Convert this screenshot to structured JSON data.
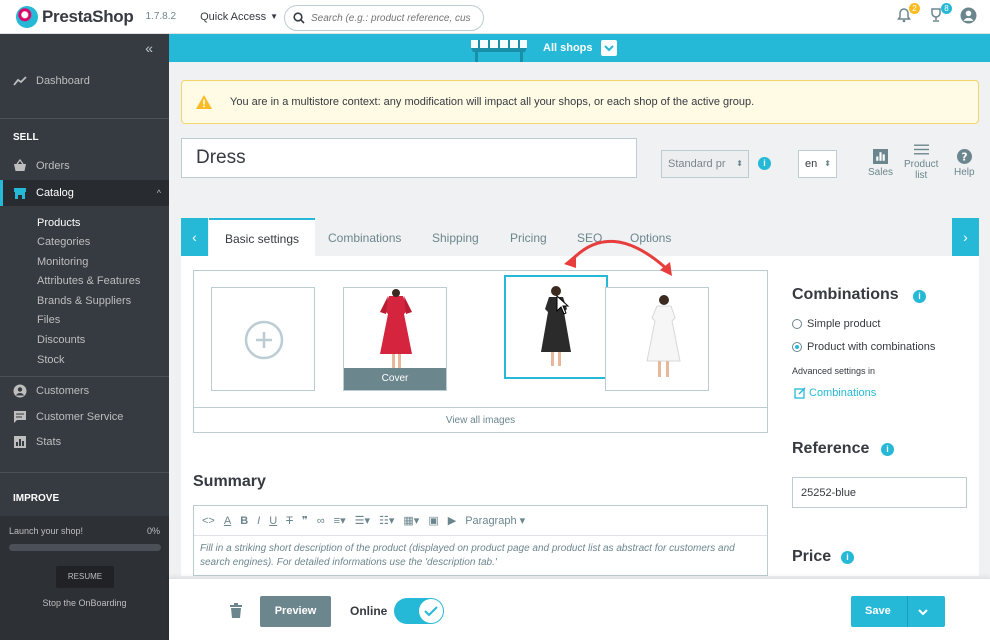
{
  "topbar": {
    "brand": "PrestaShop",
    "version": "1.7.8.2",
    "quick_access": "Quick Access",
    "search_placeholder": "Search (e.g.: product reference, custon",
    "notifications_count": "2",
    "orders_count": "8"
  },
  "sidebar": {
    "dashboard": "Dashboard",
    "section_sell": "SELL",
    "orders": "Orders",
    "catalog": "Catalog",
    "catalog_sub": [
      "Products",
      "Categories",
      "Monitoring",
      "Attributes & Features",
      "Brands & Suppliers",
      "Files",
      "Discounts",
      "Stock"
    ],
    "customers": "Customers",
    "customer_service": "Customer Service",
    "stats": "Stats",
    "section_improve": "IMPROVE",
    "launch_text": "Launch your shop!",
    "launch_pct": "0%",
    "launch_progress": 0,
    "resume": "RESUME",
    "stop_onboarding": "Stop the OnBoarding"
  },
  "shopbar": {
    "label": "All shops"
  },
  "alert": {
    "text": "You are in a multistore context: any modification will impact all your shops, or each shop of the active group."
  },
  "product": {
    "name": "Dress",
    "type": "Standard pr",
    "lang": "en"
  },
  "tools": {
    "sales": "Sales",
    "product_list_1": "Product",
    "product_list_2": "list",
    "help": "Help"
  },
  "tabs": [
    "Basic settings",
    "Combinations",
    "Shipping",
    "Pricing",
    "SEO",
    "Options"
  ],
  "images": {
    "cover_label": "Cover",
    "view_all": "View all images"
  },
  "summary": {
    "title": "Summary",
    "paragraph_select": "Paragraph",
    "placeholder": "Fill in a striking short description of the product (displayed on product page and product list as abstract for customers and search engines). For detailed informations use the 'description tab.'"
  },
  "combinations": {
    "title": "Combinations",
    "simple": "Simple product",
    "with_combinations": "Product with combinations",
    "advanced": "Advanced settings in",
    "link": "Combinations"
  },
  "reference": {
    "title": "Reference",
    "value": "25252-blue"
  },
  "price": {
    "title": "Price"
  },
  "footer": {
    "preview": "Preview",
    "online": "Online",
    "save": "Save"
  },
  "colors": {
    "accent": "#25b9d7",
    "sidebar": "#363a41",
    "dress_red": "#d4243e",
    "dress_black": "#2b2b2b"
  }
}
